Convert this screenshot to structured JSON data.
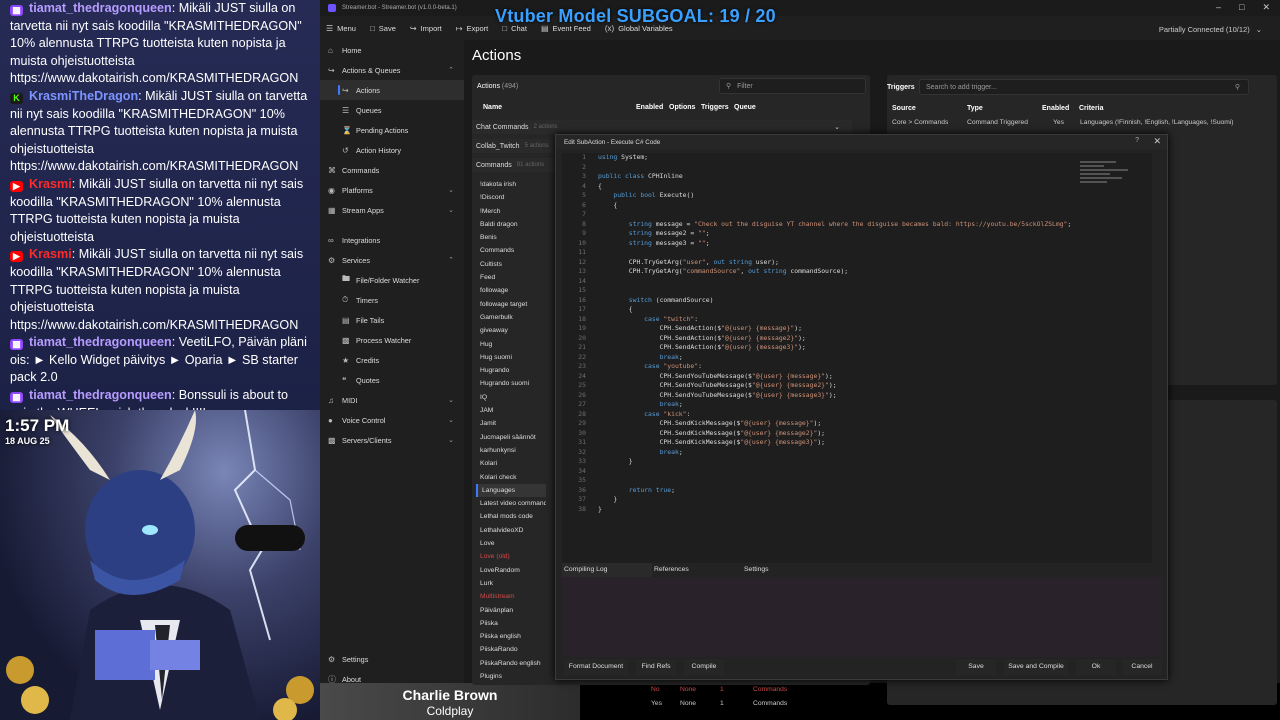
{
  "chat": {
    "messages": [
      {
        "platform": "twitch",
        "user": "tiamat_thedragonqueen",
        "text": ": Mikäli JUST siulla on tarvetta nii nyt sais koodilla \"KRASMITHEDRAGON\" 10% alennusta TTRPG tuotteista kuten nopista ja muista ohjeistuotteista https://www.dakotairish.com/KRASMITHEDRAGON"
      },
      {
        "platform": "kick",
        "user": "KrasmiTheDragon",
        "text": ": Mikäli JUST siulla on tarvetta nii nyt sais koodilla \"KRASMITHEDRAGON\" 10% alennusta TTRPG tuotteista kuten nopista ja muista ohjeistuotteista https://www.dakotairish.com/KRASMITHEDRAGON"
      },
      {
        "platform": "yt",
        "user": "Krasmi",
        "text": ": Mikäli JUST siulla on tarvetta nii nyt sais koodilla \"KRASMITHEDRAGON\" 10% alennusta TTRPG tuotteista kuten nopista ja muista ohjeistuotteista"
      },
      {
        "platform": "yt",
        "user": "Krasmi",
        "text": ": Mikäli JUST siulla on tarvetta nii nyt sais koodilla \"KRASMITHEDRAGON\" 10% alennusta TTRPG tuotteista kuten nopista ja muista ohjeistuotteista https://www.dakotairish.com/KRASMITHEDRAGON"
      },
      {
        "platform": "twitch",
        "user": "tiamat_thedragonqueen",
        "text": ": VeetiLFO, Päivän pläni ois: ► Kello Widget päivitys ► Oparia ► SB starter pack 2.0"
      },
      {
        "platform": "twitch",
        "user": "tiamat_thedragonqueen",
        "text": ": Bonssuli is about to spin the WHEEL, wish them luck!!!!"
      }
    ],
    "clock": "1:57 PM",
    "date": "18 AUG 25"
  },
  "now_playing": {
    "title": "Charlie Brown",
    "artist": "Coldplay"
  },
  "app": {
    "title": "Streamer.bot - Streamer.bot (v1.0.0-beta.1)",
    "subgoal": "Vtuber Model SUBGOAL: 19 / 20",
    "connection": "Partially Connected (10/12)",
    "toolbar": [
      "Menu",
      "Save",
      "Import",
      "Export",
      "Chat",
      "Event Feed",
      "Global Variables"
    ],
    "sidebar": [
      {
        "label": "Home",
        "icon": "home-icon",
        "sub": false
      },
      {
        "label": "Actions & Queues",
        "icon": "actions-icon",
        "sub": false,
        "chev": "^"
      },
      {
        "label": "Actions",
        "icon": "actions-icon",
        "sub": true,
        "sel": true
      },
      {
        "label": "Queues",
        "icon": "queue-icon",
        "sub": true
      },
      {
        "label": "Pending Actions",
        "icon": "pending-icon",
        "sub": true
      },
      {
        "label": "Action History",
        "icon": "history-icon",
        "sub": true
      },
      {
        "label": "Commands",
        "icon": "commands-icon",
        "sub": false
      },
      {
        "label": "Platforms",
        "icon": "platforms-icon",
        "sub": false,
        "chev": "v"
      },
      {
        "label": "Stream Apps",
        "icon": "apps-icon",
        "sub": false,
        "chev": "v"
      },
      {
        "label": "Integrations",
        "icon": "integrations-icon",
        "sub": false,
        "pad": true
      },
      {
        "label": "Services",
        "icon": "services-icon",
        "sub": false,
        "chev": "^"
      },
      {
        "label": "File/Folder Watcher",
        "icon": "folder-icon",
        "sub": true
      },
      {
        "label": "Timers",
        "icon": "timer-icon",
        "sub": true
      },
      {
        "label": "File Tails",
        "icon": "file-icon",
        "sub": true
      },
      {
        "label": "Process Watcher",
        "icon": "process-icon",
        "sub": true
      },
      {
        "label": "Credits",
        "icon": "credits-icon",
        "sub": true
      },
      {
        "label": "Quotes",
        "icon": "quotes-icon",
        "sub": true
      },
      {
        "label": "MIDI",
        "icon": "midi-icon",
        "sub": false,
        "chev": "v"
      },
      {
        "label": "Voice Control",
        "icon": "voice-icon",
        "sub": false,
        "chev": "v"
      },
      {
        "label": "Servers/Clients",
        "icon": "servers-icon",
        "sub": false,
        "chev": "v"
      }
    ],
    "sidebar_bottom": [
      "Settings",
      "About"
    ],
    "page_title": "Actions",
    "actions_header": "Actions",
    "actions_count": "(494)",
    "filter_placeholder": "Filter",
    "columns": [
      "Name",
      "Enabled",
      "Options",
      "Triggers",
      "Queue"
    ],
    "groups": [
      {
        "name": "Chat Commands",
        "count": "2 actions"
      },
      {
        "name": "Collab_Twitch",
        "count": "5 actions"
      },
      {
        "name": "Commands",
        "count": "91 actions"
      }
    ],
    "action_items": [
      {
        "name": "!dakota irish"
      },
      {
        "name": "!Discord"
      },
      {
        "name": "!Merch"
      },
      {
        "name": "Baldi dragon"
      },
      {
        "name": "Benis"
      },
      {
        "name": "Commands"
      },
      {
        "name": "Cultists"
      },
      {
        "name": "Feed"
      },
      {
        "name": "followage"
      },
      {
        "name": "followage target"
      },
      {
        "name": "Gamerbulk"
      },
      {
        "name": "giveaway"
      },
      {
        "name": "Hug"
      },
      {
        "name": "Hug suomi"
      },
      {
        "name": "Hugrando"
      },
      {
        "name": "Hugrando suomi"
      },
      {
        "name": "IQ"
      },
      {
        "name": "JAM"
      },
      {
        "name": "Jamit"
      },
      {
        "name": "Jucmapeli säännöt"
      },
      {
        "name": "karhunkynsi"
      },
      {
        "name": "Kolari"
      },
      {
        "name": "Kolari check"
      },
      {
        "name": "Languages",
        "sel": true
      },
      {
        "name": "Latest video command"
      },
      {
        "name": "Lethal mods code"
      },
      {
        "name": "LethalvideoXD"
      },
      {
        "name": "Love"
      },
      {
        "name": "Love (old)",
        "red": true
      },
      {
        "name": "LoveRandom"
      },
      {
        "name": "Lurk"
      },
      {
        "name": "Multistream",
        "red": true
      },
      {
        "name": "Päivänplan"
      },
      {
        "name": "Piiska"
      },
      {
        "name": "Piiska english"
      },
      {
        "name": "PiiskaRando"
      },
      {
        "name": "PiiskaRando english"
      },
      {
        "name": "Plugins"
      }
    ],
    "triggers": {
      "label": "Triggers",
      "search_placeholder": "Search to add trigger...",
      "columns": [
        "Source",
        "Type",
        "Enabled",
        "Criteria"
      ],
      "row": [
        "Core > Commands",
        "Command Triggered",
        "Yes",
        "Languages (!Finnish, !English, !Languages, !Suomi)"
      ]
    },
    "bottom_rows": [
      [
        "No",
        "None",
        "1",
        "Commands"
      ],
      [
        "Yes",
        "None",
        "1",
        "Commands"
      ]
    ]
  },
  "editor": {
    "title": "Edit SubAction - Execute C# Code",
    "code": [
      "using System;",
      "",
      "public class CPHInline",
      "{",
      "    public bool Execute()",
      "    {",
      "",
      "        string message = \"Check out the disguise YT channel where the disguise becames bald: https://youtu.be/5sckOlZSLmg\";",
      "        string message2 = \"\";",
      "        string message3 = \"\";",
      "",
      "        CPH.TryGetArg(\"user\", out string user);",
      "        CPH.TryGetArg(\"commandSource\", out string commandSource);",
      "",
      "",
      "        switch (commandSource)",
      "        {",
      "            case \"twitch\":",
      "                CPH.SendAction($\"@{user} {message}\");",
      "                CPH.SendAction($\"@{user} {message2}\");",
      "                CPH.SendAction($\"@{user} {message3}\");",
      "                break;",
      "            case \"youtube\":",
      "                CPH.SendYouTubeMessage($\"@{user} {message}\");",
      "                CPH.SendYouTubeMessage($\"@{user} {message2}\");",
      "                CPH.SendYouTubeMessage($\"@{user} {message3}\");",
      "                break;",
      "            case \"kick\":",
      "                CPH.SendKickMessage($\"@{user} {message}\");",
      "                CPH.SendKickMessage($\"@{user} {message2}\");",
      "                CPH.SendKickMessage($\"@{user} {message3}\");",
      "                break;",
      "        }",
      "",
      "",
      "        return true;",
      "    }",
      "}"
    ],
    "tabs": [
      "Compiling Log",
      "References",
      "Settings"
    ],
    "buttons_left": [
      "Format Document",
      "Find Refs",
      "Compile"
    ],
    "buttons_right": [
      "Save",
      "Save and Compile",
      "Ok",
      "Cancel"
    ]
  },
  "colors": {
    "accent": "#3a7bff",
    "subgoal": "#3aa0ff",
    "chat_bg": "#262b55"
  }
}
